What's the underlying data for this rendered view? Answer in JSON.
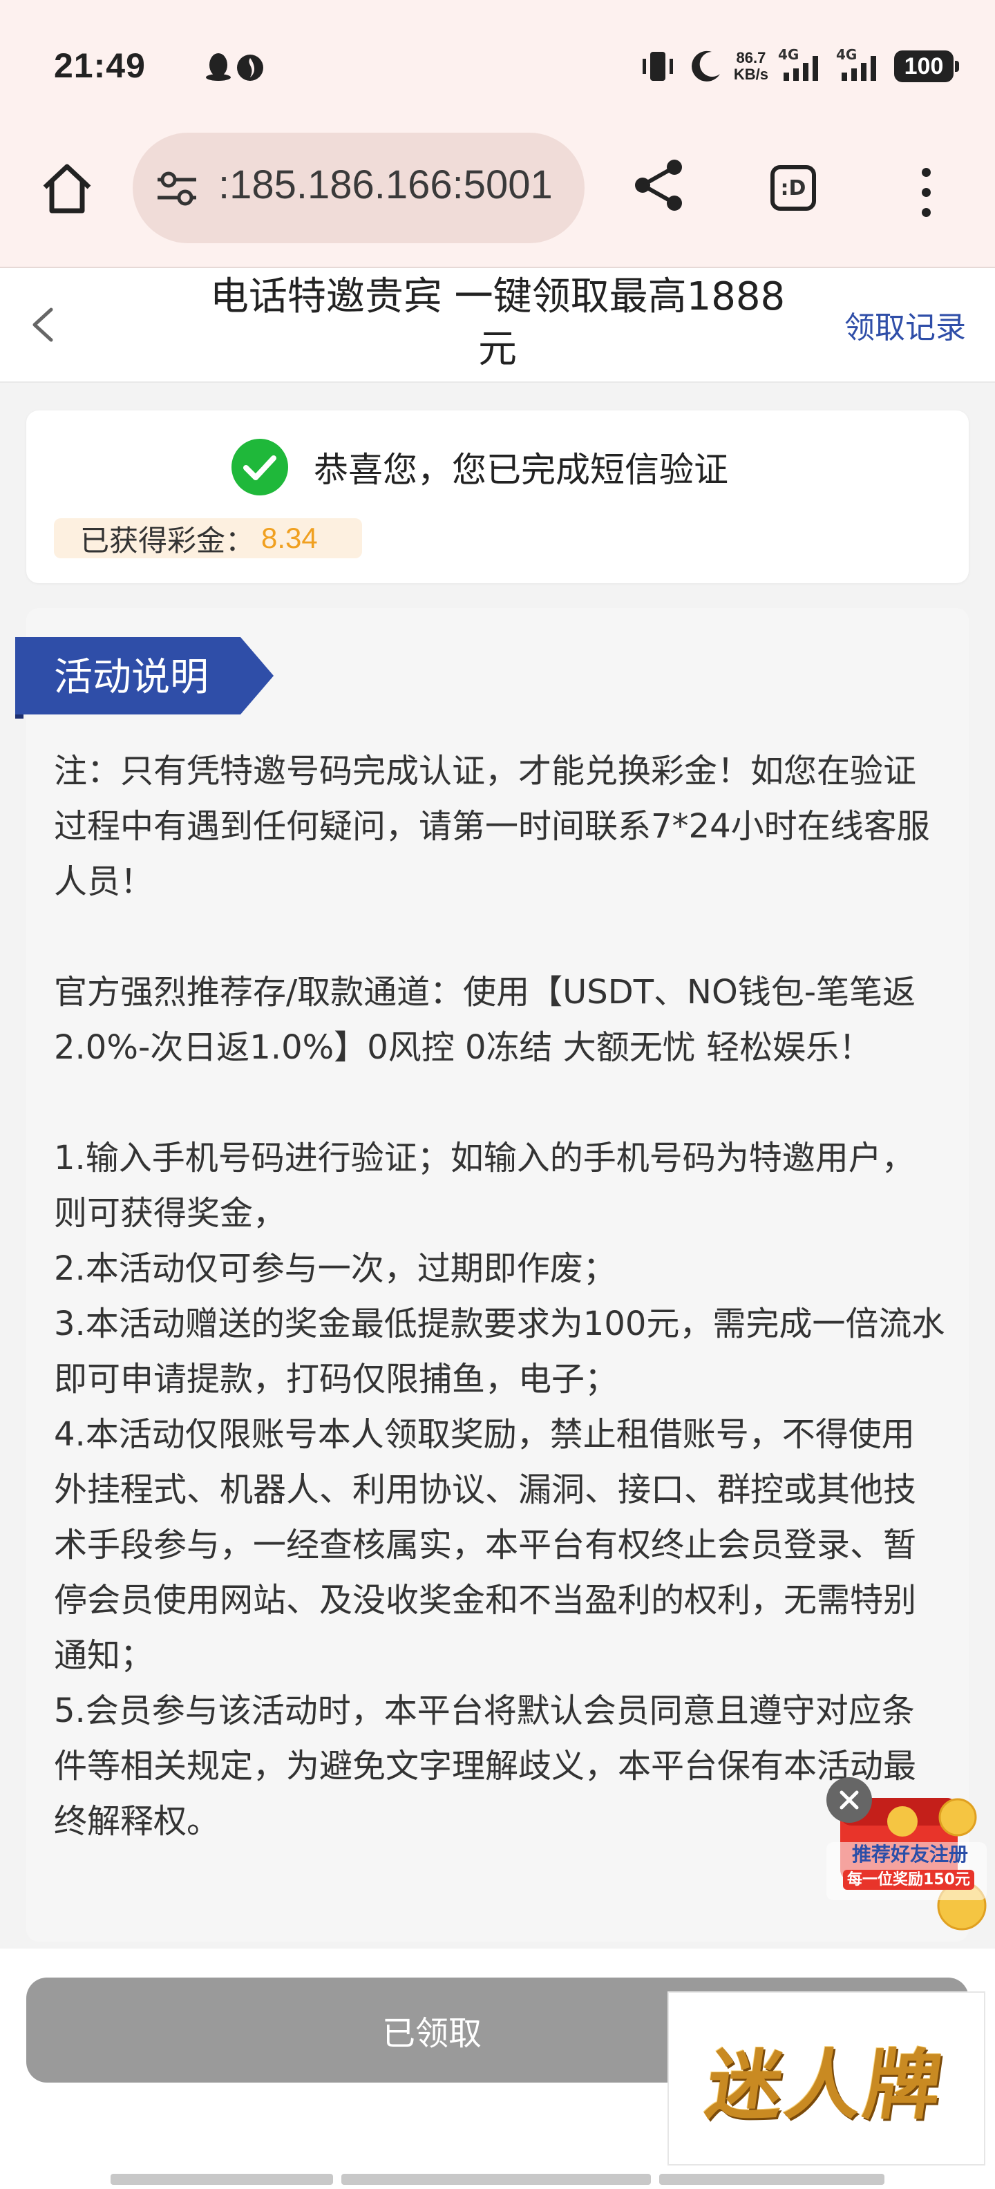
{
  "status_bar": {
    "time": "21:49",
    "net_speed_value": "86.7",
    "net_speed_unit": "KB/s",
    "sim1_label": "4G",
    "sim2_label": "4G",
    "battery": "100"
  },
  "browser": {
    "url": ":185.186.166:5001",
    "tab_switcher_label": ":D"
  },
  "header": {
    "title": "电话特邀贵宾 一键领取最高1888元",
    "records_link": "领取记录"
  },
  "verification": {
    "message": "恭喜您，您已完成短信验证",
    "bonus_label": "已获得彩金：",
    "bonus_value": "8.34"
  },
  "activity": {
    "heading": "活动说明",
    "note": "注：只有凭特邀号码完成认证，才能兑换彩金！如您在验证过程中有遇到任何疑问，请第一时间联系7*24小时在线客服人员！",
    "channel": "官方强烈推荐存/取款通道：使用【USDT、NO钱包-笔笔返2.0%-次日返1.0%】0风控 0冻结 大额无忧 轻松娱乐！",
    "rules": [
      "1.输入手机号码进行验证；如输入的手机号码为特邀用户，则可获得奖金，",
      "2.本活动仅可参与一次，过期即作废；",
      "3.本活动赠送的奖金最低提款要求为100元，需完成一倍流水即可申请提款，打码仅限捕鱼，电子；",
      "4.本活动仅限账号本人领取奖励，禁止租借账号，不得使用外挂程式、机器人、利用协议、漏洞、接口、群控或其他技术手段参与，一经查核属实，本平台有权终止会员登录、暂停会员使用网站、及没收奖金和不当盈利的权利，无需特别通知；",
      "5.会员参与该活动时，本平台将默认会员同意且遵守对应条件等相关规定，为避免文字理解歧义，本平台保有本活动最终解释权。"
    ]
  },
  "floating_ad": {
    "line1": "推荐好友注册",
    "line2": "每一位奖励150元"
  },
  "claim_button": "已领取",
  "brand_logo_text": "迷人牌",
  "colors": {
    "accent_blue": "#2f4ea8",
    "success_green": "#1fb83a",
    "bonus_orange": "#f0a020",
    "disabled_gray": "#9a9a9a"
  }
}
